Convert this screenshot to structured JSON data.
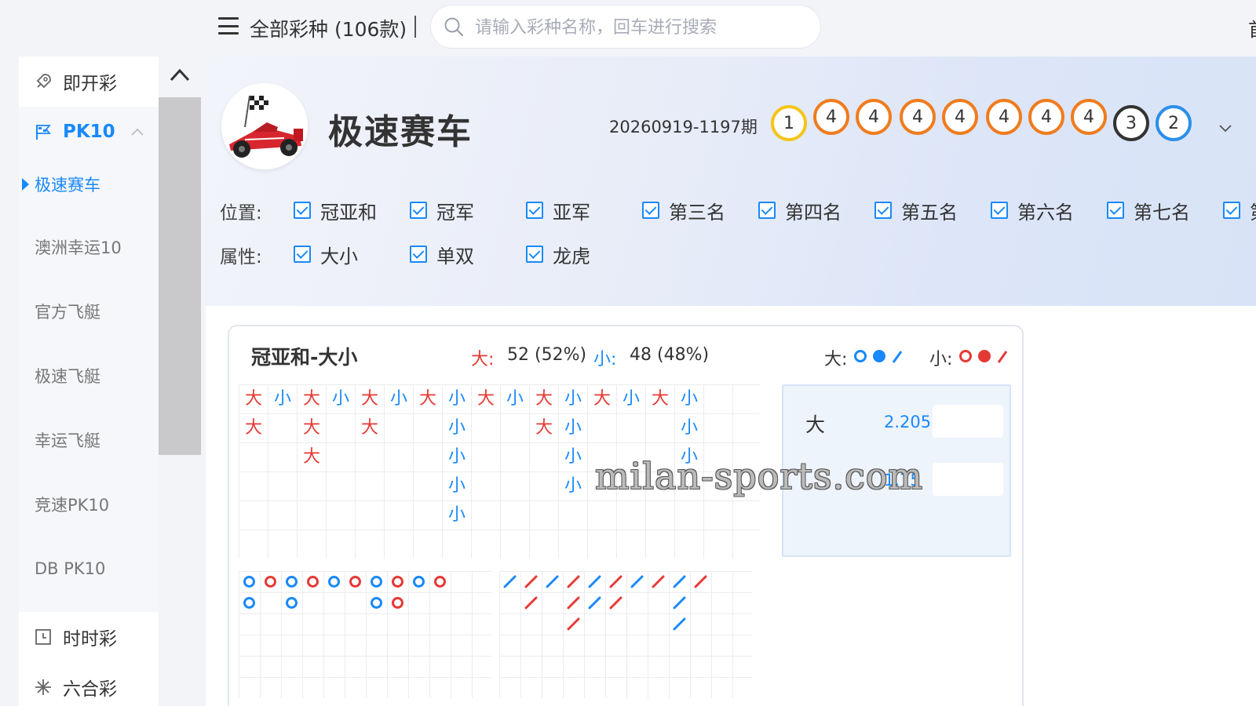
{
  "topbar": {
    "all_label": "全部彩种 (106款)",
    "search_placeholder": "请输入彩种名称，回车进行搜索",
    "corner_text": "首"
  },
  "sidebar": {
    "cat_instant": "即开彩",
    "cat_pk10": "PK10",
    "pk10_items": [
      "极速赛车",
      "澳洲幸运10",
      "官方飞艇",
      "极速飞艇",
      "幸运飞艇",
      "竞速PK10",
      "DB PK10"
    ],
    "cat_ssc": "时时彩",
    "cat_lhc": "六合彩"
  },
  "header": {
    "game_title": "极速赛车",
    "issue": "20260919-1197期",
    "balls": [
      {
        "num": "1",
        "color": "#f5c518"
      },
      {
        "num": "4",
        "color": "#f07c1e"
      },
      {
        "num": "4",
        "color": "#f07c1e"
      },
      {
        "num": "4",
        "color": "#f07c1e"
      },
      {
        "num": "4",
        "color": "#f07c1e"
      },
      {
        "num": "4",
        "color": "#f07c1e"
      },
      {
        "num": "4",
        "color": "#f07c1e"
      },
      {
        "num": "4",
        "color": "#f07c1e"
      },
      {
        "num": "3",
        "color": "#333333"
      },
      {
        "num": "2",
        "color": "#2c8fe8"
      }
    ],
    "position_label": "位置:",
    "positions": [
      "冠亚和",
      "冠军",
      "亚军",
      "第三名",
      "第四名",
      "第五名",
      "第六名",
      "第七名",
      "第"
    ],
    "attr_label": "属性:",
    "attributes": [
      "大小",
      "单双",
      "龙虎"
    ]
  },
  "card": {
    "title": "冠亚和-大小",
    "big_label": "大:",
    "big_value": "52 (52%)",
    "small_label": "小:",
    "small_value": "48 (48%)",
    "legend_big": "大:",
    "legend_small": "小:",
    "big_char": "大",
    "small_char": "小",
    "road_columns": [
      [
        "大",
        "大"
      ],
      [
        "小"
      ],
      [
        "大",
        "大",
        "大"
      ],
      [
        "小"
      ],
      [
        "大",
        "大"
      ],
      [
        "小"
      ],
      [
        "大"
      ],
      [
        "小",
        "小",
        "小",
        "小",
        "小"
      ],
      [
        "大"
      ],
      [
        "小"
      ],
      [
        "大",
        "大"
      ],
      [
        "小",
        "小",
        "小",
        "小"
      ],
      [
        "大"
      ],
      [
        "小"
      ],
      [
        "大"
      ],
      [
        "小",
        "小",
        "小"
      ]
    ],
    "bead_columns": [
      [
        "b",
        "b"
      ],
      [
        "r"
      ],
      [
        "b",
        "b"
      ],
      [
        "r"
      ],
      [
        "b"
      ],
      [
        "r"
      ],
      [
        "b",
        "b"
      ],
      [
        "r",
        "r"
      ],
      [
        "b"
      ],
      [
        "r"
      ]
    ],
    "slash_columns": [
      [
        "b"
      ],
      [
        "r",
        "r"
      ],
      [
        "b"
      ],
      [
        "r",
        "r",
        "r"
      ],
      [
        "b",
        "b"
      ],
      [
        "r",
        "r"
      ],
      [
        "b"
      ],
      [
        "r"
      ],
      [
        "b",
        "b",
        "b"
      ],
      [
        "r"
      ]
    ],
    "odds_big_label": "大",
    "odds_big_value": "2.205",
    "odds_small_value": "1.75"
  },
  "colors": {
    "accent": "#1989fa",
    "big": "#e53935",
    "small": "#1989fa"
  },
  "watermark": "milan-sports.com"
}
